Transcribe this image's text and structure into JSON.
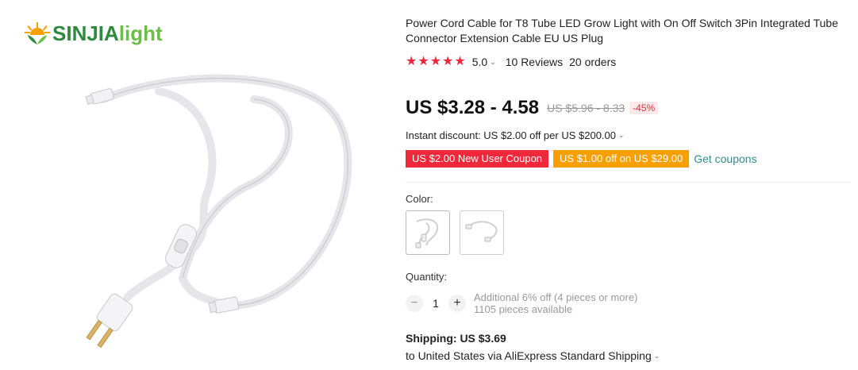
{
  "logo": {
    "text_a": "SINJIA",
    "text_b": "light"
  },
  "product": {
    "title": "Power Cord Cable for T8 Tube LED Grow Light with On Off Switch 3Pin Integrated Tube Connector Extension Cable EU US Plug",
    "rating": "5.0",
    "stars": 5,
    "reviews": "10 Reviews",
    "orders": "20 orders"
  },
  "price": {
    "current": "US $3.28 - 4.58",
    "original": "US $5.96 - 8.33",
    "discount": "-45%"
  },
  "instant_discount": "Instant discount: US $2.00 off per US $200.00",
  "coupons": {
    "new_user": "US $2.00 New User Coupon",
    "store": "US $1.00 off on US $29.00",
    "get_label": "Get coupons"
  },
  "color": {
    "label": "Color:",
    "options": [
      "US plug with switch",
      "Connector cable"
    ]
  },
  "quantity": {
    "label": "Quantity:",
    "value": "1",
    "additional": "Additional 6% off (4 pieces or more)",
    "available": "1105 pieces available"
  },
  "shipping": {
    "label": "Shipping:",
    "cost": "US $3.69",
    "description": "to United States via AliExpress Standard Shipping"
  },
  "colors": {
    "accent_red": "#f0283c",
    "accent_orange": "#f7a000",
    "link_teal": "#2f8f8f"
  }
}
